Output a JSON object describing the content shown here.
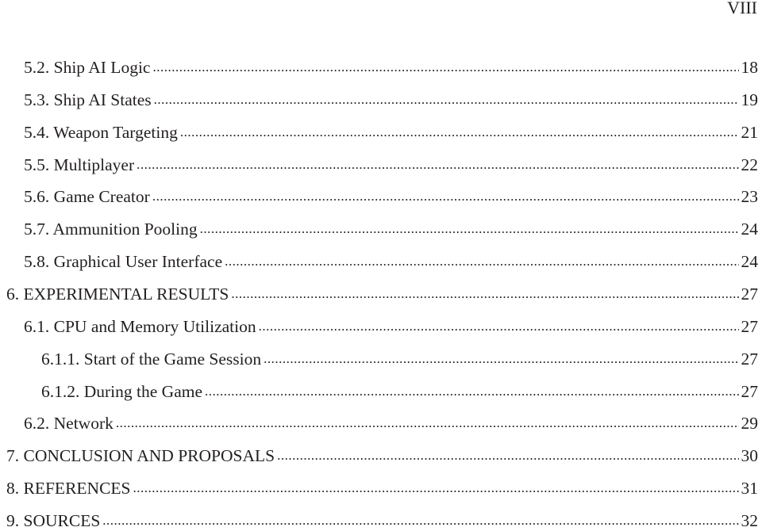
{
  "page_number": "VIII",
  "entries": [
    {
      "title": "5.2. Ship AI Logic",
      "page": "18",
      "level": 2
    },
    {
      "title": "5.3. Ship AI States",
      "page": "19",
      "level": 2
    },
    {
      "title": "5.4. Weapon Targeting",
      "page": "21",
      "level": 2
    },
    {
      "title": "5.5. Multiplayer",
      "page": "22",
      "level": 2
    },
    {
      "title": "5.6. Game Creator",
      "page": "23",
      "level": 2
    },
    {
      "title": "5.7. Ammunition Pooling",
      "page": "24",
      "level": 2
    },
    {
      "title": "5.8. Graphical User Interface",
      "page": "24",
      "level": 2
    },
    {
      "title": "6. EXPERIMENTAL RESULTS",
      "page": "27",
      "level": 1
    },
    {
      "title": "6.1. CPU and Memory Utilization",
      "page": "27",
      "level": 2
    },
    {
      "title": "6.1.1. Start of the Game Session",
      "page": "27",
      "level": 3
    },
    {
      "title": "6.1.2. During the Game",
      "page": "27",
      "level": 3
    },
    {
      "title": "6.2. Network",
      "page": "29",
      "level": 2
    },
    {
      "title": "7. CONCLUSION AND PROPOSALS",
      "page": "30",
      "level": 1
    },
    {
      "title": "8. REFERENCES",
      "page": "31",
      "level": 1
    },
    {
      "title": "9. SOURCES",
      "page": "32",
      "level": 1
    }
  ]
}
